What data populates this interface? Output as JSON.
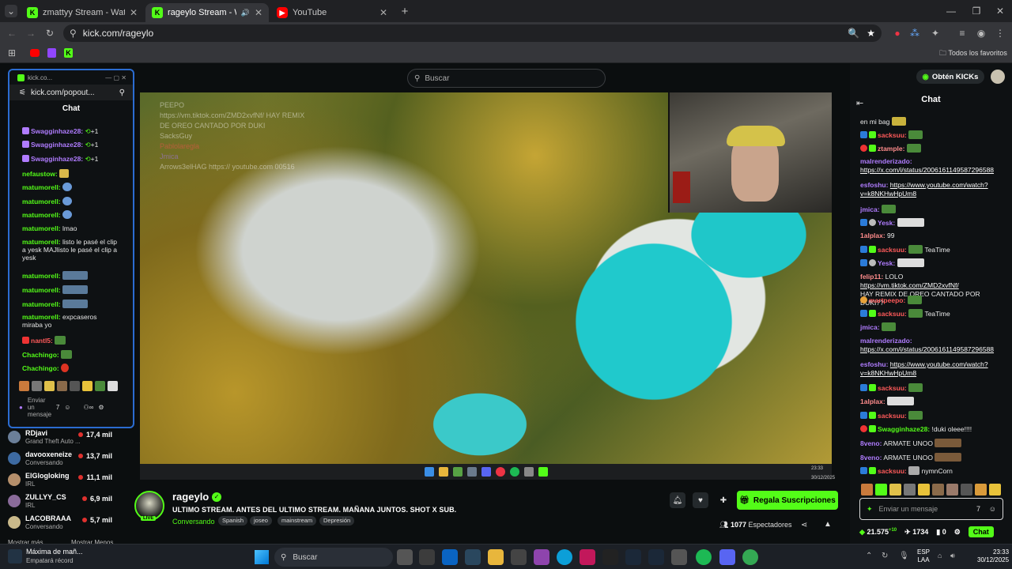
{
  "browser": {
    "tabs": [
      {
        "title": "zmattyy Stream - Watch Live on",
        "fav_color": "#53fc18",
        "fav": "K"
      },
      {
        "title": "rageylo Stream - Watch Live",
        "fav_color": "#53fc18",
        "fav": "K"
      },
      {
        "title": "YouTube",
        "fav_color": "#ff0000",
        "fav": "▶"
      }
    ],
    "url": "kick.com/rageylo",
    "bookmarks_all": "Todos los favoritos"
  },
  "page": {
    "search_placeholder": "Buscar",
    "kicks_button": "Obtén KICKs",
    "chat_title": "Chat",
    "accent": "#53fc18"
  },
  "popout": {
    "window_title": "kick.co...",
    "url": "kick.com/popout...",
    "chat_title": "Chat",
    "input_placeholder": "Enviar un mensaje",
    "messages": [
      {
        "user": "Swagginhaze28:",
        "text": "+1",
        "color": "#b07cff"
      },
      {
        "user": "Swagginhaze28:",
        "text": "+1",
        "color": "#b07cff"
      },
      {
        "user": "Swagginhaze28:",
        "text": "+1",
        "color": "#b07cff"
      },
      {
        "user": "nefaustow:",
        "text": "",
        "color": "#53fc18"
      },
      {
        "user": "matumorell:",
        "text": "",
        "color": "#53fc18"
      },
      {
        "user": "matumorell:",
        "text": "",
        "color": "#53fc18"
      },
      {
        "user": "matumorell:",
        "text": "",
        "color": "#53fc18"
      },
      {
        "user": "matumorell:",
        "text": "lmao",
        "color": "#53fc18"
      },
      {
        "user": "matumorell:",
        "text": "listo le pasé el clip a yesk MAJlisto le pasé el clip a yesk",
        "color": "#53fc18"
      },
      {
        "user": "matumorell:",
        "text": "",
        "color": "#53fc18"
      },
      {
        "user": "matumorell:",
        "text": "",
        "color": "#53fc18"
      },
      {
        "user": "matumorell:",
        "text": "",
        "color": "#53fc18"
      },
      {
        "user": "matumorell:",
        "text": "expcaseros miraba yo",
        "color": "#53fc18"
      },
      {
        "user": "nantl5:",
        "text": "",
        "color": "#ff5a5a"
      },
      {
        "user": "Chachingo:",
        "text": "",
        "color": "#53fc18"
      },
      {
        "user": "Chachingo:",
        "text": "",
        "color": "#53fc18"
      }
    ]
  },
  "sidebar": {
    "channels": [
      {
        "name": "RDjavi",
        "category": "Grand Theft Auto ...",
        "viewers": "17,4 mil",
        "color": "#6b7f99"
      },
      {
        "name": "davooxeneize",
        "category": "Conversando",
        "viewers": "13,7 mil",
        "color": "#3d6aa1"
      },
      {
        "name": "ElGlogloking",
        "category": "IRL",
        "viewers": "11,1 mil",
        "color": "#b58f6b"
      },
      {
        "name": "ZULLYY_CS",
        "category": "IRL",
        "viewers": "6,9 mil",
        "color": "#8a6b9a"
      },
      {
        "name": "LACOBRAAA",
        "category": "Conversando",
        "viewers": "5,7 mil",
        "color": "#c9b98a"
      }
    ],
    "show_more": "Mostrar más",
    "show_less": "Mostrar Menos"
  },
  "stream": {
    "streamer": "rageylo",
    "live_badge": "LIVE",
    "title": "ULTIMO STREAM. ANTES DEL ULTIMO STREAM. MAÑANA JUNTOS. SHOT X SUB.",
    "category": "Conversando",
    "tags": [
      "Spanish",
      "joseo",
      "mainstream",
      "Depresión"
    ],
    "gift_button": "Regala Suscripciones",
    "viewers": "1077",
    "viewers_label": "Espectadores"
  },
  "chat": {
    "input_placeholder": "Enviar un mensaje",
    "messages": [
      {
        "user": "",
        "text": "en mi bag",
        "link": "",
        "color": "#ffffff"
      },
      {
        "user": "sacksuu:",
        "text": "",
        "link": "",
        "color": "#ff5a5a"
      },
      {
        "user": "ztample:",
        "text": "",
        "link": "",
        "color": "#ff8c8c"
      },
      {
        "user": "malrenderizado:",
        "text": "",
        "link": "https://x.com/i/status/2006161149587296588",
        "color": "#b07cff"
      },
      {
        "user": "esfoshu:",
        "text": "",
        "link": "https://www.youtube.com/watch?v=k8NKHwHpUm8",
        "color": "#b07cff"
      },
      {
        "user": "jmica:",
        "text": "",
        "link": "",
        "color": "#b07cff"
      },
      {
        "user": "Yesk:",
        "text": "",
        "link": "",
        "color": "#b07cff"
      },
      {
        "user": "1alplax:",
        "text": "99",
        "link": "",
        "color": "#ff8c8c"
      },
      {
        "user": "sacksuu:",
        "text": "TeaTime",
        "link": "",
        "color": "#ff5a5a"
      },
      {
        "user": "Yesk:",
        "text": "",
        "link": "",
        "color": "#b07cff"
      },
      {
        "user": "felip11:",
        "text": "LOLO",
        "link": "https://vm.tiktok.com/ZMD2xvfNf/",
        "extra": "HAY REMIX DE OREO CANTADO POR DUKI??",
        "color": "#ff8c8c"
      },
      {
        "user": "martpeepo:",
        "text": "",
        "link": "",
        "color": "#ff5a5a"
      },
      {
        "user": "sacksuu:",
        "text": "TeaTime",
        "link": "",
        "color": "#ff5a5a"
      },
      {
        "user": "jmica:",
        "text": "",
        "link": "",
        "color": "#b07cff"
      },
      {
        "user": "malrenderizado:",
        "text": "",
        "link": "https://x.com/i/status/2006161149587296588",
        "color": "#b07cff"
      },
      {
        "user": "esfoshu:",
        "text": "",
        "link": "https://www.youtube.com/watch?v=k8NKHwHpUm8",
        "color": "#b07cff"
      },
      {
        "user": "sacksuu:",
        "text": "",
        "link": "",
        "color": "#ff5a5a"
      },
      {
        "user": "1alplax:",
        "text": "",
        "link": "",
        "color": "#ff8c8c"
      },
      {
        "user": "sacksuu:",
        "text": "",
        "link": "",
        "color": "#ff5a5a"
      },
      {
        "user": "Swagginhaze28:",
        "text": "!duki oleee!!!!",
        "link": "",
        "color": "#53fc18"
      },
      {
        "user": "8veno:",
        "text": "ARMATE UNOO",
        "link": "",
        "color": "#b07cff"
      },
      {
        "user": "8veno:",
        "text": "ARMATE UNOO",
        "link": "",
        "color": "#b07cff"
      },
      {
        "user": "sacksuu:",
        "text": "nymnCorn",
        "link": "",
        "color": "#ff5a5a"
      }
    ],
    "footer": {
      "kicks": "21.575",
      "kicks_sup": "+10",
      "points": "1734",
      "count": "0",
      "button": "Chat"
    }
  },
  "video": {
    "overlay_lines": [
      "PEEPO",
      "https://vm.tiktok.com/ZMD2xvfNf/ HAY REMIX",
      "DE OREO CANTADO POR DUKI",
      "SacksGuy",
      "Pablolaregla",
      "Jmica",
      "Arrows3elHAG https:// youtube.com 00516"
    ],
    "stream_clock": "23:33",
    "stream_date": "30/12/2025"
  },
  "taskbar": {
    "now_playing_title": "Máxima de mañ...",
    "now_playing_sub": "Empatará récord",
    "search": "Buscar",
    "lang": "ESP",
    "lang_sub": "LAA",
    "time": "23:33",
    "date": "30/12/2025"
  }
}
